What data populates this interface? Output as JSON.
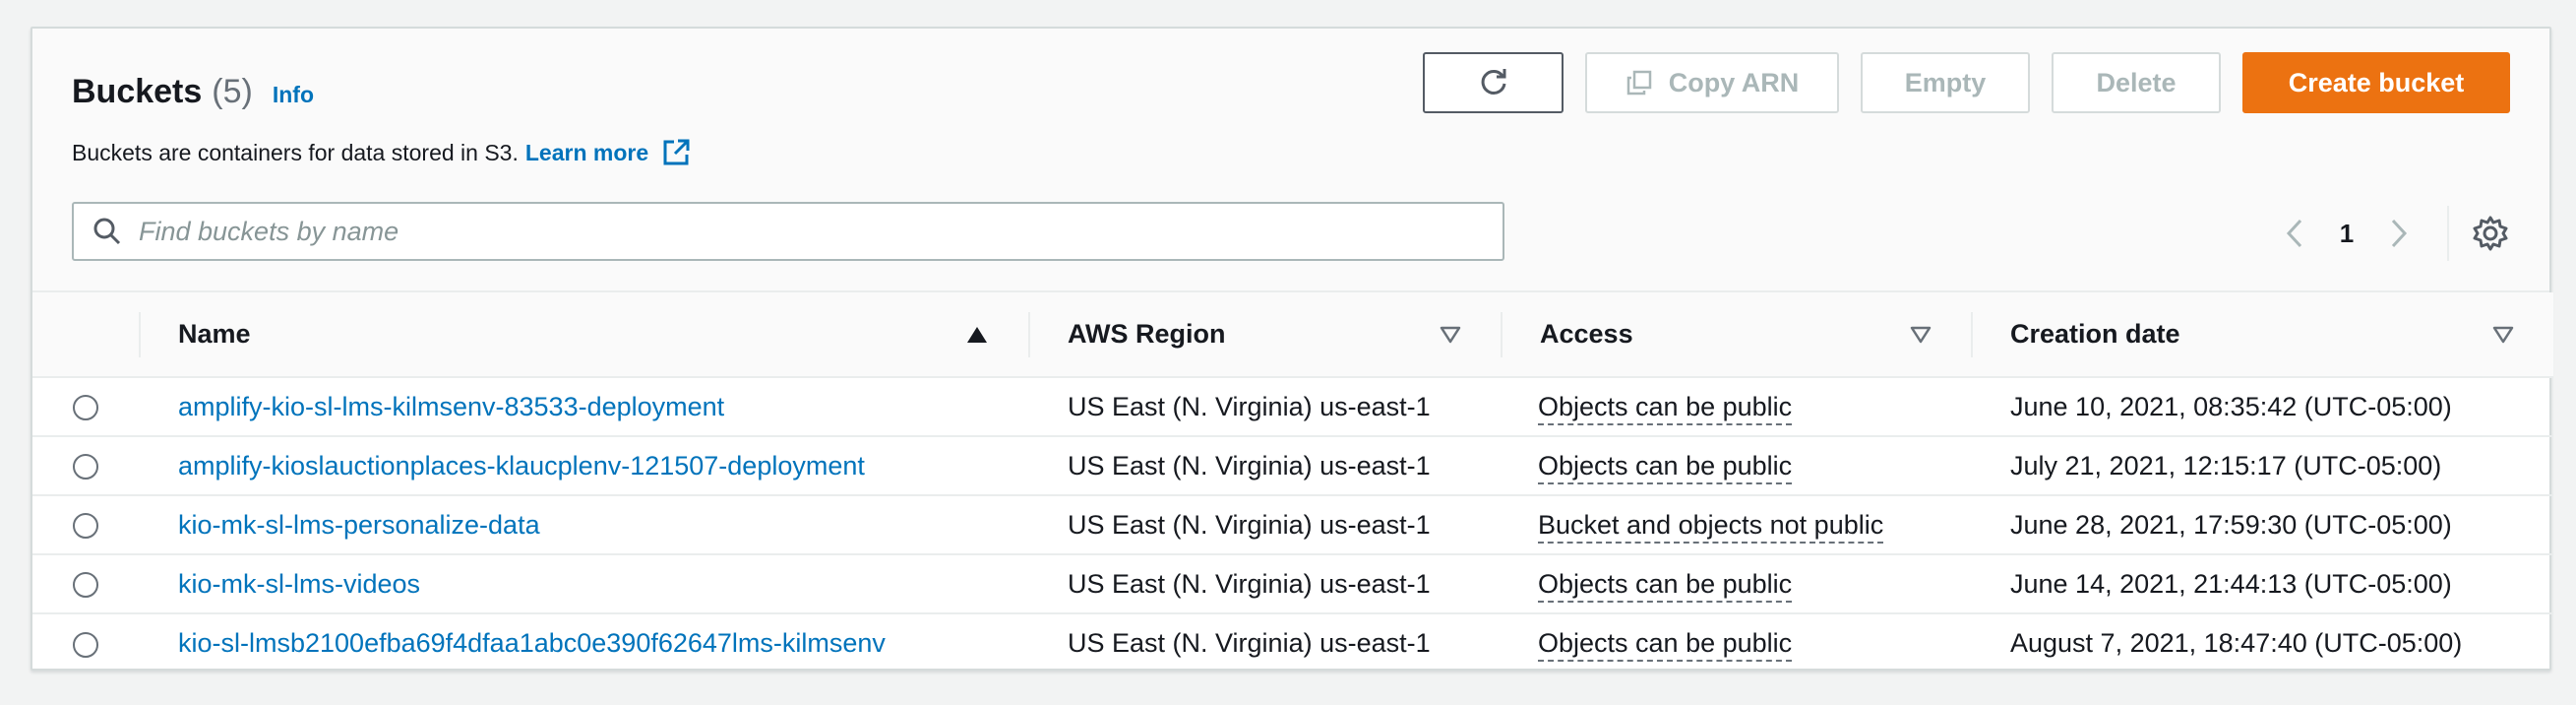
{
  "header": {
    "title": "Buckets",
    "count": "(5)",
    "info_label": "Info",
    "description": "Buckets are containers for data stored in S3.",
    "learn_more_label": "Learn more"
  },
  "actions": {
    "refresh_icon": "refresh-icon",
    "copy_arn_label": "Copy ARN",
    "empty_label": "Empty",
    "delete_label": "Delete",
    "create_label": "Create bucket"
  },
  "search": {
    "placeholder": "Find buckets by name",
    "value": ""
  },
  "pagination": {
    "current_page": "1"
  },
  "table": {
    "columns": [
      {
        "label": "Name",
        "sort": "ascending"
      },
      {
        "label": "AWS Region",
        "sort": "none"
      },
      {
        "label": "Access",
        "sort": "none"
      },
      {
        "label": "Creation date",
        "sort": "none"
      }
    ],
    "rows": [
      {
        "name": "amplify-kio-sl-lms-kilmsenv-83533-deployment",
        "region": "US East (N. Virginia) us-east-1",
        "access": "Objects can be public",
        "created": "June 10, 2021, 08:35:42 (UTC-05:00)"
      },
      {
        "name": "amplify-kioslauctionplaces-klaucplenv-121507-deployment",
        "region": "US East (N. Virginia) us-east-1",
        "access": "Objects can be public",
        "created": "July 21, 2021, 12:15:17 (UTC-05:00)"
      },
      {
        "name": "kio-mk-sl-lms-personalize-data",
        "region": "US East (N. Virginia) us-east-1",
        "access": "Bucket and objects not public",
        "created": "June 28, 2021, 17:59:30 (UTC-05:00)"
      },
      {
        "name": "kio-mk-sl-lms-videos",
        "region": "US East (N. Virginia) us-east-1",
        "access": "Objects can be public",
        "created": "June 14, 2021, 21:44:13 (UTC-05:00)"
      },
      {
        "name": "kio-sl-lmsb2100efba69f4dfaa1abc0e390f62647lms-kilmsenv",
        "region": "US East (N. Virginia) us-east-1",
        "access": "Objects can be public",
        "created": "August 7, 2021, 18:47:40 (UTC-05:00)"
      }
    ]
  },
  "colors": {
    "link": "#0073bb",
    "primary": "#ec7211",
    "border": "#d5dbdb"
  }
}
